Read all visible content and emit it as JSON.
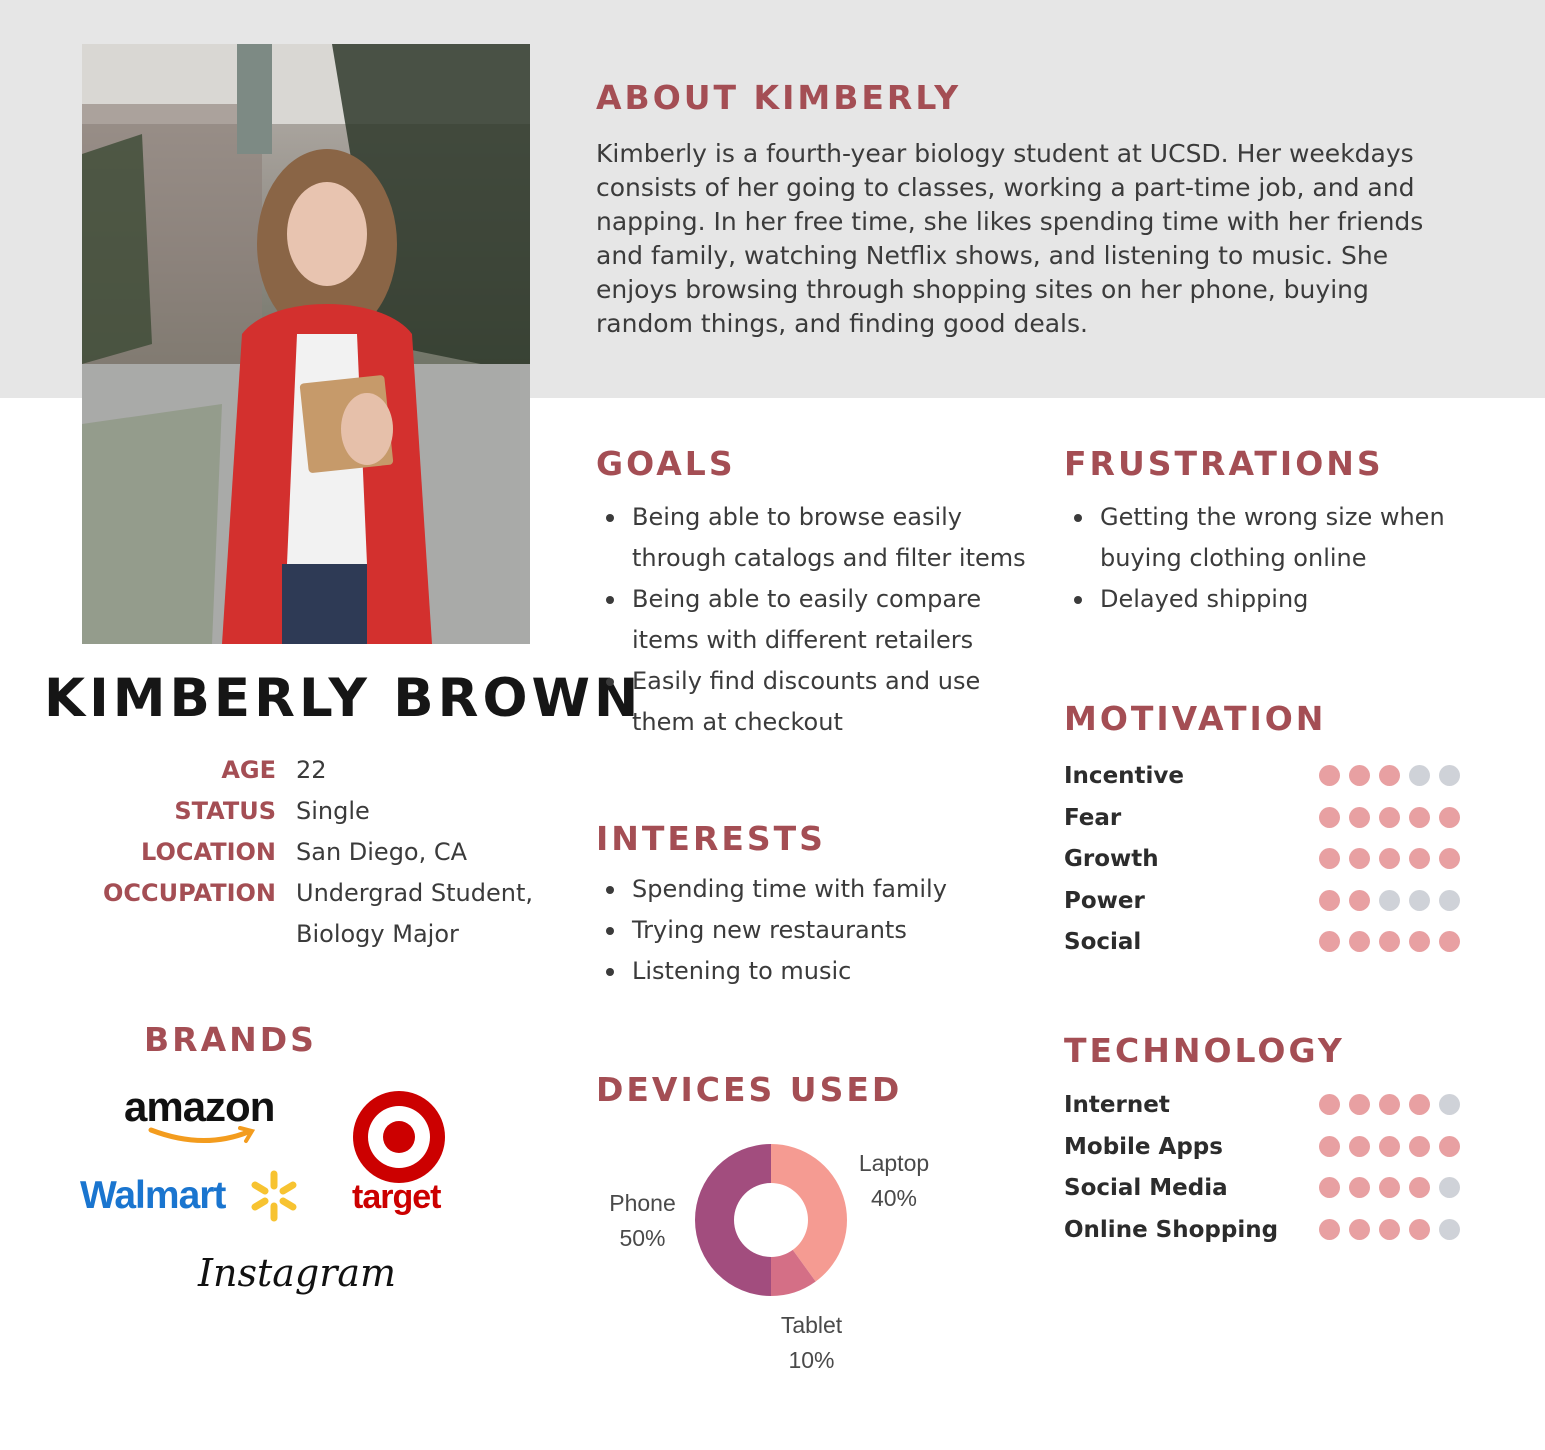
{
  "about": {
    "heading": "ABOUT KIMBERLY",
    "lines": [
      "Kimberly is a fourth-year biology student at UCSD. Her weekdays",
      "consists of her going to classes, working a part-time job, and and",
      "napping. In her free time, she likes spending time with her friends",
      "and family, watching Netflix shows, and listening to music. She",
      "enjoys browsing through shopping sites on her phone, buying",
      "random things, and finding good deals."
    ]
  },
  "profile": {
    "name": "KIMBERLY BROWN",
    "facts": [
      {
        "label": "AGE",
        "value": "22"
      },
      {
        "label": "STATUS",
        "value": "Single"
      },
      {
        "label": "LOCATION",
        "value": "San Diego, CA"
      },
      {
        "label": "OCCUPATION",
        "value": "Undergrad Student,",
        "value2": "Biology Major"
      }
    ]
  },
  "goals": {
    "heading": "GOALS",
    "items": [
      [
        "Being able to browse easily",
        "through catalogs and filter items"
      ],
      [
        "Being able to easily compare",
        "items with different retailers"
      ],
      [
        "Easily find discounts and use",
        "them at checkout"
      ]
    ]
  },
  "frustrations": {
    "heading": "FRUSTRATIONS",
    "items": [
      [
        "Getting the wrong size when",
        "buying clothing online"
      ],
      [
        "Delayed shipping"
      ]
    ]
  },
  "interests": {
    "heading": "INTERESTS",
    "items": [
      "Spending time with family",
      "Trying new restaurants",
      "Listening to music"
    ]
  },
  "brands": {
    "heading": "BRANDS",
    "logos": [
      "amazon",
      "target",
      "Walmart",
      "Instagram"
    ]
  },
  "motivation": {
    "heading": "MOTIVATION",
    "items": [
      {
        "label": "Incentive",
        "score": 3
      },
      {
        "label": "Fear",
        "score": 5
      },
      {
        "label": "Growth",
        "score": 5
      },
      {
        "label": "Power",
        "score": 2
      },
      {
        "label": "Social",
        "score": 5
      }
    ]
  },
  "technology": {
    "heading": "TECHNOLOGY",
    "items": [
      {
        "label": "Internet",
        "score": 4
      },
      {
        "label": "Mobile Apps",
        "score": 5
      },
      {
        "label": "Social Media",
        "score": 4
      },
      {
        "label": "Online Shopping",
        "score": 4
      }
    ]
  },
  "colors": {
    "accent": "#a44e54",
    "dot_on": "#e8a0a2",
    "dot_off": "#cfd2d8"
  },
  "devices": {
    "heading": "DEVICES USED",
    "chart_data": {
      "type": "pie",
      "donut": true,
      "slices": [
        {
          "name": "Laptop",
          "value": 40,
          "label": "40%",
          "color": "#f59b92"
        },
        {
          "name": "Tablet",
          "value": 10,
          "label": "10%",
          "color": "#d46f86"
        },
        {
          "name": "Phone",
          "value": 50,
          "label": "50%",
          "color": "#a24d7e"
        }
      ]
    }
  }
}
